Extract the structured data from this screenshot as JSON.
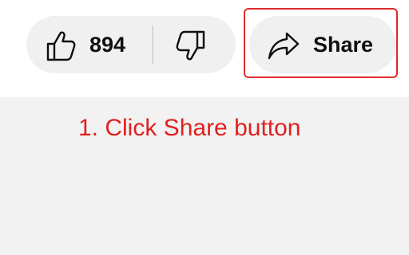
{
  "video_actions": {
    "like": {
      "icon": "thumbs-up-icon",
      "count": "894"
    },
    "dislike": {
      "icon": "thumbs-down-icon"
    },
    "share": {
      "icon": "share-arrow-icon",
      "label": "Share"
    }
  },
  "annotation": {
    "instruction": "1. Click Share button",
    "color": "#e02020"
  },
  "colors": {
    "button_background": "#f0f0f0",
    "panel_background": "#f2f2f2",
    "highlight_border": "#e02a2a"
  }
}
